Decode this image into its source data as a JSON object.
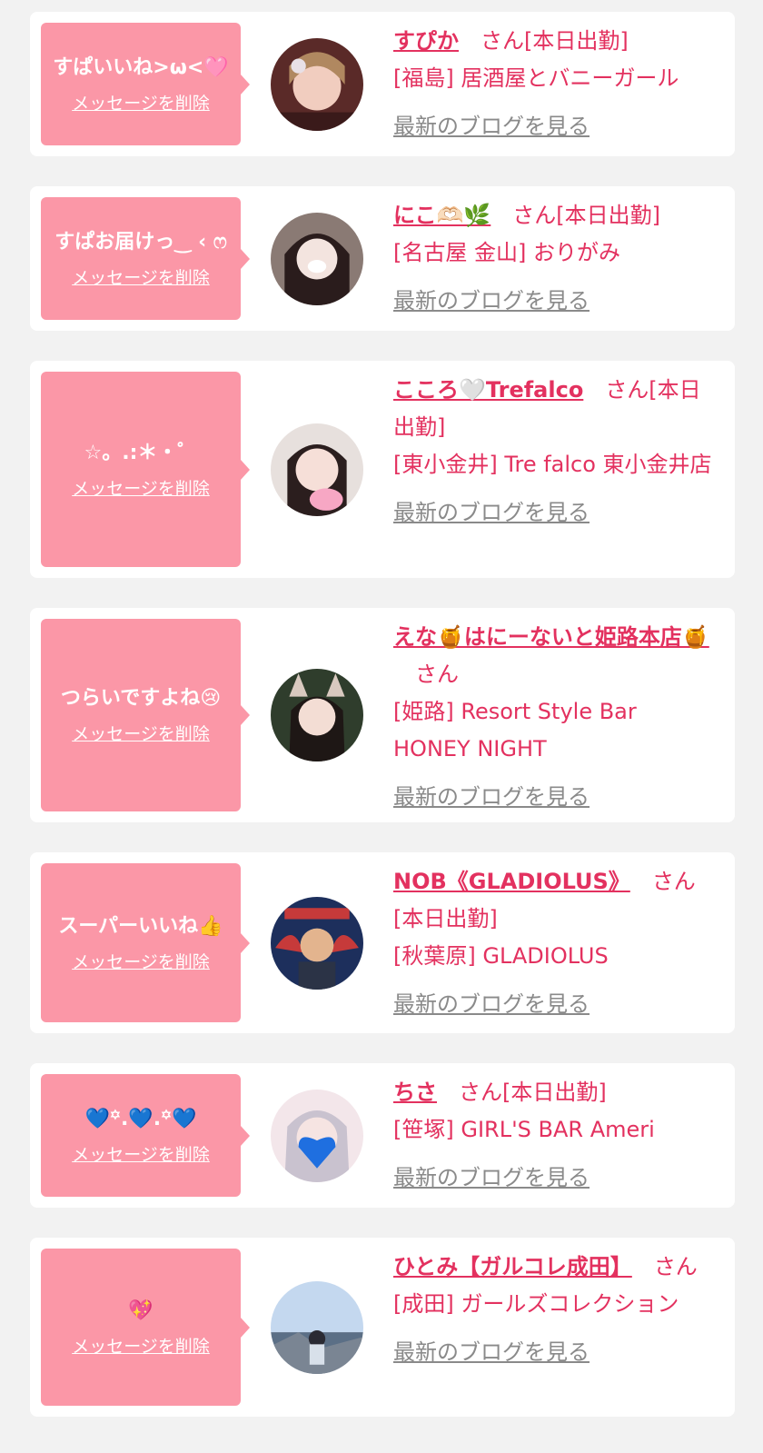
{
  "common": {
    "delete_label": "メッセージを削除",
    "blog_label": "最新のブログを見る"
  },
  "colors": {
    "bubble": "#fb97a7",
    "accent": "#e3315f",
    "link_gray": "#8a8a8a",
    "background": "#f2f2f2"
  },
  "items": [
    {
      "message": "すぱいいね>ω<🩷",
      "name": "すぴか",
      "suffix": "さん[本日出勤]",
      "shop": "[福島] 居酒屋とバニーガール"
    },
    {
      "message": "すぱお届けっ‿ ‹ ෆ",
      "name": "にこ🫶🏻🌿",
      "suffix": "さん[本日出勤]",
      "shop": "[名古屋 金山] おりがみ"
    },
    {
      "message": "☆。.:＊・゜",
      "name": "こころ🤍Trefalco",
      "suffix": "さん[本日出勤]",
      "shop": "[東小金井] Tre falco 東小金井店"
    },
    {
      "message": "つらいですよね😢",
      "name": "えな🍯はにーないと姫路本店🍯",
      "suffix": "さん",
      "shop": "[姫路] Resort Style Bar HONEY NIGHT"
    },
    {
      "message": "スーパーいいね👍",
      "name": "NOB《GLADIOLUS》",
      "suffix": "さん[本日出勤]",
      "shop": "[秋葉原] GLADIOLUS"
    },
    {
      "message": "💙꙳.💙.꙳💙",
      "name": "ちさ",
      "suffix": "さん[本日出勤]",
      "shop": "[笹塚] GIRL'S BAR Ameri"
    },
    {
      "message": "💖",
      "name": "ひとみ【ガルコレ成田】",
      "suffix": "さん",
      "shop": "[成田] ガールズコレクション"
    }
  ]
}
